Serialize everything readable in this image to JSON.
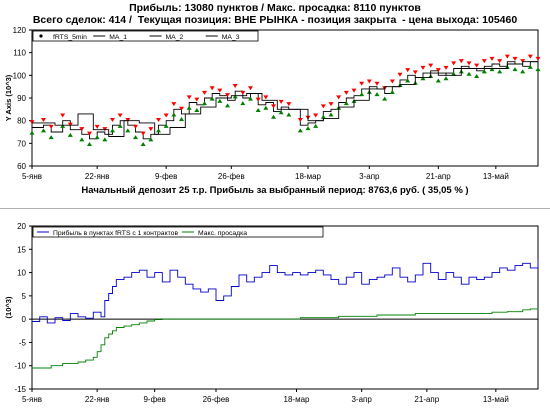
{
  "header": {
    "line1": "Прибыль: 13080 пунктов / Макс. просадка: 8110 пунктов",
    "line2": "Всего сделок: 414 /  Текущая позиция: ВНЕ РЫНКА - позиция закрыта  - цена выхода: 105460"
  },
  "middle_caption": "Начальный депозит 25 т.р. Прибыль за выбранный период: 8763,6 руб. ( 35,05 % )",
  "colors": {
    "price": "#000000",
    "ma1": "#000000",
    "up": "#ff0000",
    "down": "#008000",
    "profit": "#0000cc",
    "drawdown": "#008000"
  },
  "chart_data": [
    {
      "type": "line",
      "ylabel": "Y Axis (10^3)",
      "ylim": [
        60,
        120
      ],
      "yticks": [
        60,
        70,
        80,
        90,
        100,
        110,
        120
      ],
      "xlim": [
        0,
        132
      ],
      "xticks": [
        {
          "x": 0,
          "label": "5-янв"
        },
        {
          "x": 17,
          "label": "22-янв"
        },
        {
          "x": 35,
          "label": "9-фев"
        },
        {
          "x": 52,
          "label": "26-фев"
        },
        {
          "x": 72,
          "label": "18-мар"
        },
        {
          "x": 88,
          "label": "3-апр"
        },
        {
          "x": 106,
          "label": "21-апр"
        },
        {
          "x": 121,
          "label": "13-май"
        }
      ],
      "legend": {
        "position": "top-left",
        "items": [
          "fRTS_5min",
          "MA_1",
          "MA_2",
          "MA_3"
        ]
      },
      "series": [
        {
          "name": "fRTS_5min",
          "x": [
            0,
            3,
            5,
            8,
            10,
            13,
            15,
            17,
            19,
            21,
            23,
            25,
            27,
            29,
            31,
            33,
            35,
            37,
            39,
            41,
            43,
            45,
            47,
            49,
            51,
            53,
            55,
            57,
            59,
            61,
            63,
            65,
            67,
            70,
            72,
            74,
            76,
            78,
            80,
            82,
            84,
            86,
            88,
            90,
            92,
            94,
            96,
            98,
            100,
            102,
            104,
            106,
            108,
            110,
            112,
            114,
            116,
            118,
            120,
            122,
            124,
            126,
            128,
            130,
            132
          ],
          "values": [
            77,
            78,
            75,
            80,
            76,
            74,
            72,
            75,
            74,
            78,
            80,
            78,
            75,
            72,
            74,
            78,
            80,
            85,
            83,
            88,
            87,
            90,
            92,
            91,
            89,
            93,
            90,
            92,
            87,
            88,
            84,
            86,
            85,
            78,
            79,
            80,
            84,
            85,
            88,
            90,
            91,
            94,
            95,
            94,
            92,
            95,
            98,
            100,
            99,
            101,
            102,
            100,
            101,
            103,
            104,
            103,
            102,
            104,
            105,
            104,
            106,
            105,
            104,
            106,
            105
          ]
        },
        {
          "name": "MA_1",
          "x": [
            0,
            6,
            12,
            16,
            20,
            24,
            28,
            32,
            36,
            40,
            44,
            48,
            52,
            56,
            60,
            64,
            68,
            72,
            76,
            80,
            84,
            88,
            92,
            96,
            100,
            104,
            108,
            112,
            116,
            120,
            124,
            128,
            132
          ],
          "values": [
            79,
            78,
            83,
            76,
            73,
            80,
            79,
            74,
            77,
            83,
            86,
            90,
            91,
            92,
            89,
            85,
            85,
            80,
            81,
            86,
            89,
            94,
            95,
            96,
            99,
            101,
            100,
            103,
            103,
            103,
            105,
            106,
            105
          ]
        }
      ]
    },
    {
      "type": "line",
      "ylabel": "(10^3)",
      "ylim": [
        -15,
        20
      ],
      "yticks": [
        -15,
        -10,
        -5,
        0,
        5,
        10,
        15,
        20
      ],
      "xlim": [
        0,
        132
      ],
      "xticks": [
        {
          "x": 0,
          "label": "5-янв"
        },
        {
          "x": 17,
          "label": "22-янв"
        },
        {
          "x": 32,
          "label": "9-фев"
        },
        {
          "x": 48,
          "label": "26-фев"
        },
        {
          "x": 69,
          "label": "18-мар"
        },
        {
          "x": 86,
          "label": "3-апр"
        },
        {
          "x": 103,
          "label": "21-апр"
        },
        {
          "x": 121,
          "label": "13-май"
        }
      ],
      "legend": {
        "position": "top-left",
        "items": [
          "Прибыль в пунктах fRTS с 1 контрактов",
          "Макс. просадка"
        ]
      },
      "series": [
        {
          "name": "Прибыль в пунктах fRTS с 1 контрактов",
          "x": [
            0,
            2,
            4,
            6,
            8,
            10,
            12,
            14,
            16,
            18,
            19,
            20,
            21,
            22,
            24,
            26,
            28,
            30,
            32,
            34,
            36,
            38,
            40,
            42,
            44,
            46,
            48,
            50,
            52,
            54,
            56,
            58,
            60,
            62,
            64,
            66,
            68,
            70,
            72,
            74,
            76,
            78,
            80,
            82,
            84,
            86,
            88,
            90,
            92,
            94,
            96,
            98,
            100,
            102,
            104,
            106,
            108,
            110,
            112,
            114,
            116,
            118,
            120,
            122,
            124,
            126,
            128,
            130,
            132
          ],
          "values": [
            -0.5,
            0.5,
            -0.8,
            0.3,
            -0.3,
            1.2,
            0.5,
            0.2,
            1.5,
            0.5,
            4,
            5.5,
            7,
            8.5,
            9,
            10,
            10.5,
            9,
            10,
            8,
            10.5,
            9,
            7.5,
            6.5,
            5.8,
            6.5,
            4,
            5,
            7,
            9.5,
            8,
            9,
            10,
            11.5,
            10,
            9.5,
            10,
            9.5,
            10,
            10.5,
            9.5,
            8.5,
            7.5,
            9,
            10,
            7.5,
            8.5,
            9,
            9.5,
            11,
            9,
            8,
            9.5,
            12,
            10,
            8.5,
            10,
            9,
            7.5,
            9,
            8.5,
            9,
            10,
            11,
            10.5,
            11.5,
            12,
            11,
            13
          ]
        },
        {
          "name": "Макс. просадка",
          "x": [
            0,
            4,
            5,
            8,
            12,
            14,
            16,
            17,
            18,
            19,
            20,
            21,
            22,
            24,
            26,
            28,
            30,
            32,
            34,
            36,
            40,
            48,
            60,
            70,
            80,
            90,
            100,
            110,
            118,
            120,
            124,
            128,
            130,
            132
          ],
          "values": [
            -10.5,
            -10.5,
            -10,
            -9.5,
            -9.2,
            -8.8,
            -8.2,
            -7,
            -5.5,
            -4,
            -3.2,
            -2.5,
            -1.8,
            -1.5,
            -1.2,
            -0.8,
            -0.4,
            -0.1,
            0,
            0,
            0,
            0,
            0,
            0.3,
            0.6,
            0.9,
            1.2,
            1.2,
            1.2,
            1.5,
            1.6,
            2,
            2.2,
            2.3
          ]
        }
      ]
    }
  ]
}
